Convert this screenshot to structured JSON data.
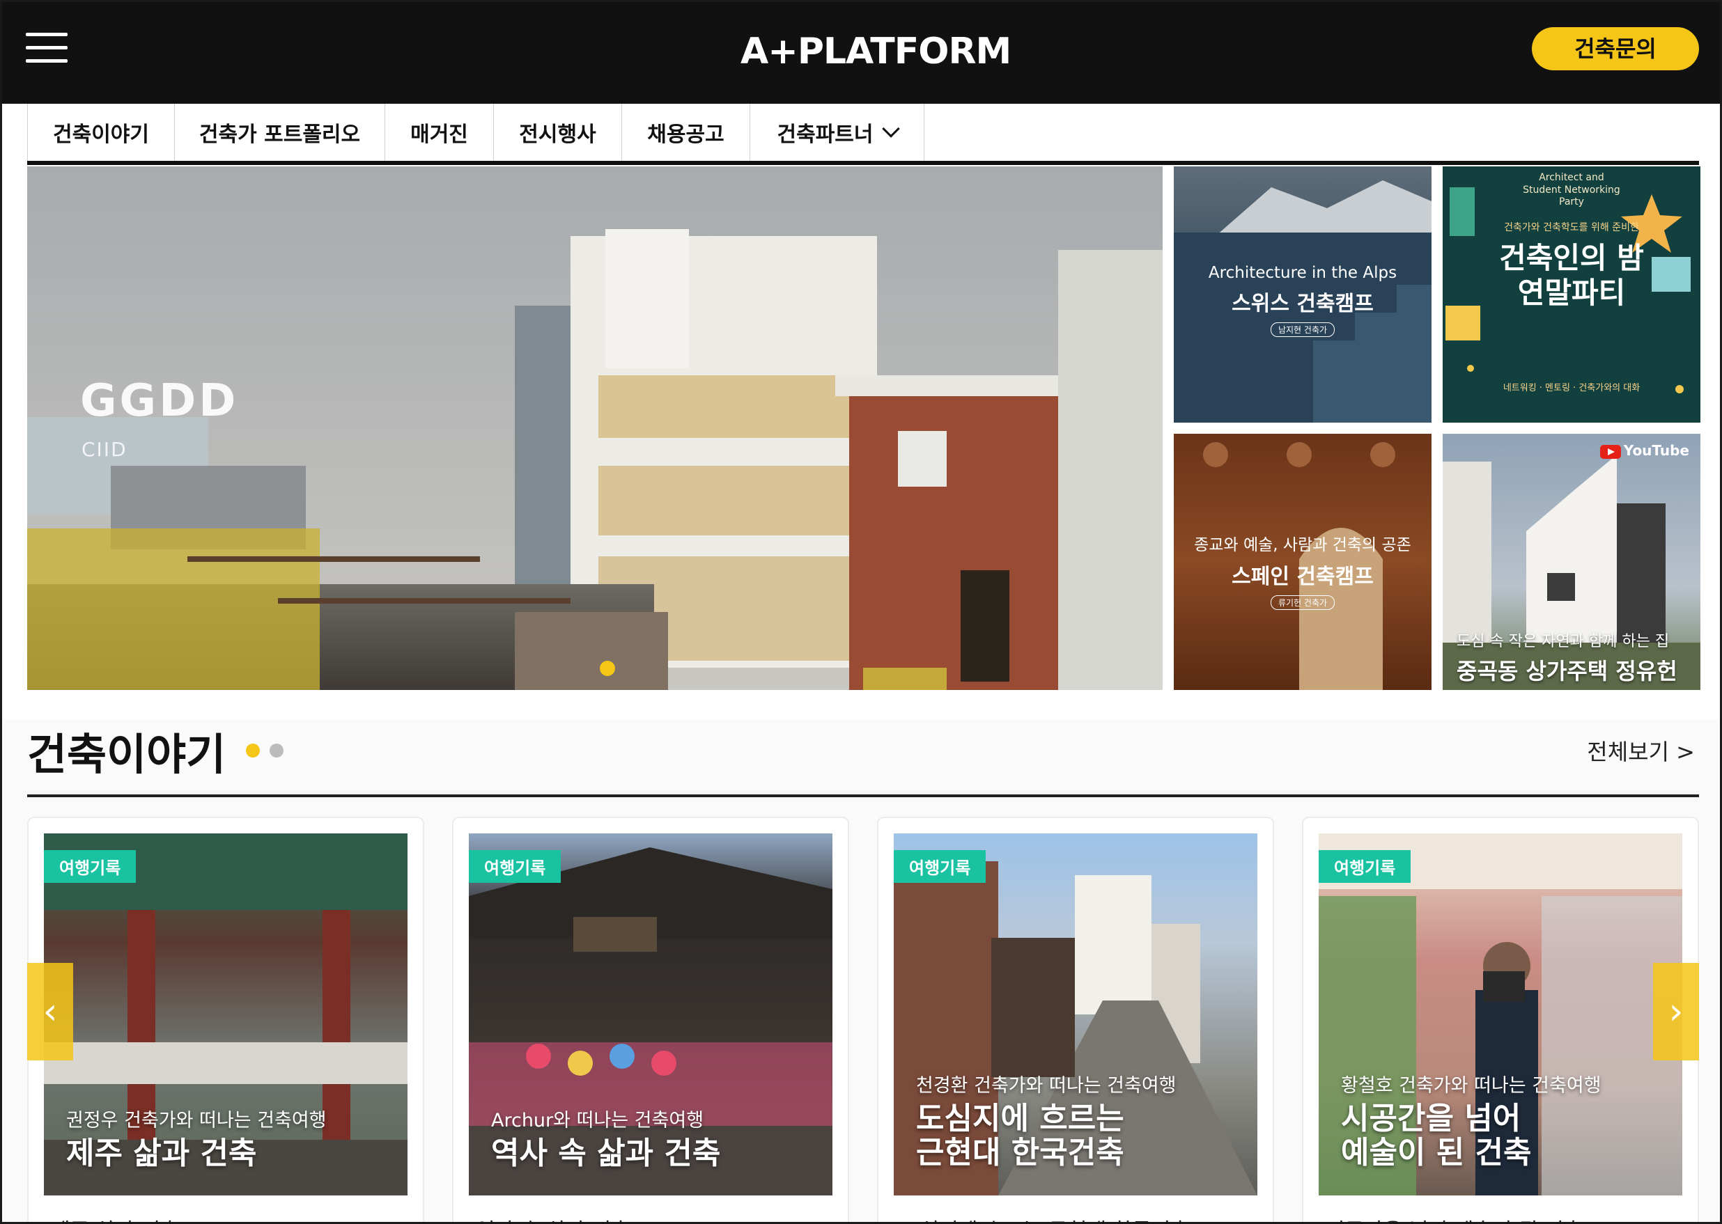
{
  "header": {
    "logo": "A+PLATFORM",
    "inquiry_label": "건축문의",
    "accent_color": "#f5c518"
  },
  "nav": {
    "tabs": [
      {
        "label": "건축이야기"
      },
      {
        "label": "건축가 포트폴리오"
      },
      {
        "label": "매거진"
      },
      {
        "label": "전시행사"
      },
      {
        "label": "채용공고"
      },
      {
        "label": "건축파트너"
      }
    ],
    "dropdown_icon": "chevron-down-icon"
  },
  "hero": {
    "title": "GGDD",
    "subtitle": "CIID",
    "slide_indicator": "dot"
  },
  "side_cards": [
    {
      "small": "Architecture in the Alps",
      "big": "스위스 건축캠프",
      "tag": "남지현 건축가"
    },
    {
      "small": "Architect and Student Networking Party",
      "pre": "건축가와 건축학도를 위해 준비한",
      "big": "건축인의 밤 연말파티",
      "foot": "네트워킹 · 멘토링 · 건축가와의 대화"
    },
    {
      "small": "종교와 예술, 사람과 건축의 공존",
      "big": "스페인 건축캠프",
      "tag": "류기헌 건축가"
    },
    {
      "small": "도심 속 작은 자연과 함께 하는 집",
      "big": "중곡동 상가주택 정유헌",
      "badge": "YouTube"
    }
  ],
  "section": {
    "title": "건축이야기",
    "view_all": "전체보기 >"
  },
  "cards": [
    {
      "badge": "여행기록",
      "cap_small": "권정우 건축가와 떠나는 건축여행",
      "cap_big": "제주 삶과 건축",
      "title": "제주 삶과 건축"
    },
    {
      "badge": "여행기록",
      "cap_small": "Archur와 떠나는 건축여행",
      "cap_big": "역사 속 삶과 건축",
      "title": "역사 속 삶과 건축"
    },
    {
      "badge": "여행기록",
      "cap_small": "천경환 건축가와 떠나는 건축여행",
      "cap_big": "도심지에 흐르는 근현대 한국건축",
      "title": "도심지에 흐르는 근현대 한국건축"
    },
    {
      "badge": "여행기록",
      "cap_small": "황철호 건축가와 떠나는 건축여행",
      "cap_big": "시공간을 넘어 예술이 된 건축",
      "title": "시공간을 넘어 예술이 된 건축"
    }
  ],
  "carousel": {
    "prev_icon": "chevron-left-icon",
    "next_icon": "chevron-right-icon"
  }
}
